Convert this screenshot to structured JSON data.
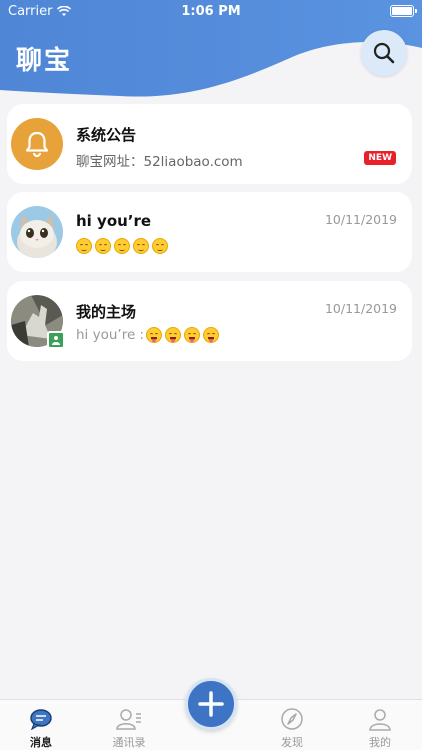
{
  "status_bar": {
    "carrier": "Carrier",
    "time": "1:06 PM"
  },
  "header": {
    "title": "聊宝",
    "accent": "#4a86d8"
  },
  "conversations": [
    {
      "name": "系统公告",
      "subtitle": "聊宝网址：52liaobao.com",
      "badge": "NEW",
      "avatar_icon": "bell-icon"
    },
    {
      "name": "hi you’re",
      "date": "10/11/2019",
      "emoji_count": 5,
      "avatar_icon": "cat-avatar"
    },
    {
      "name": "我的主场",
      "date": "10/11/2019",
      "subtitle_prefix": "hi you’re :",
      "emoji_count": 4,
      "avatar_icon": "group-avatar"
    }
  ],
  "tabbar": {
    "items": [
      {
        "label": "消息",
        "icon": "message-icon",
        "active": true
      },
      {
        "label": "通讯录",
        "icon": "contacts-icon",
        "active": false
      },
      {
        "label": "发现",
        "icon": "discover-icon",
        "active": false
      },
      {
        "label": "我的",
        "icon": "profile-icon",
        "active": false
      }
    ],
    "add_icon": "plus-icon"
  }
}
